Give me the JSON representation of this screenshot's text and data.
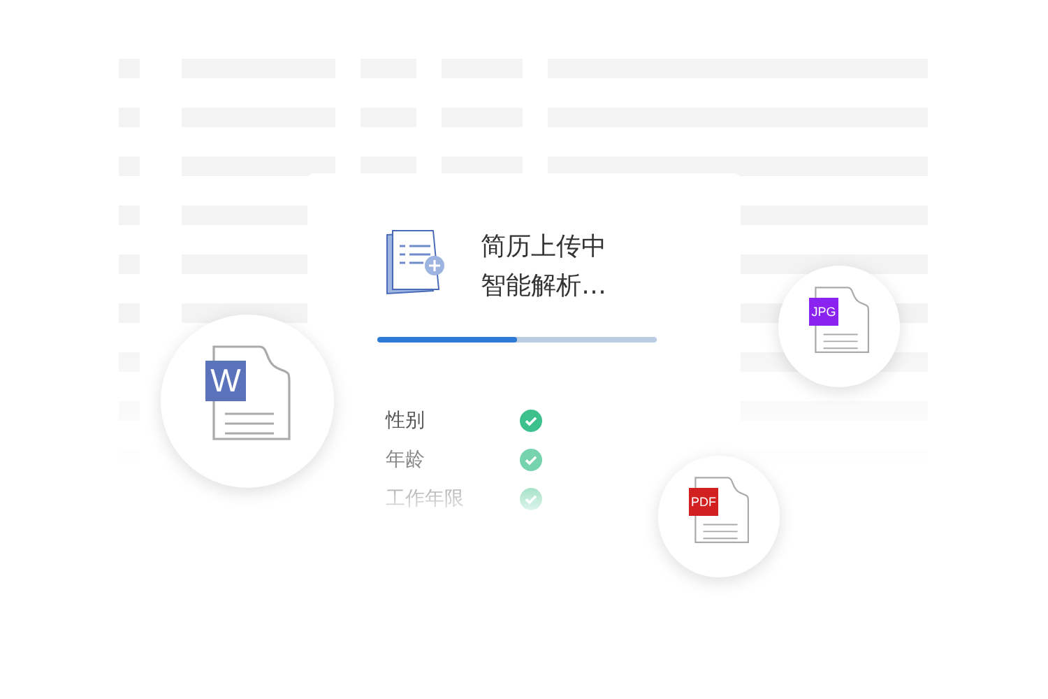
{
  "upload_card": {
    "title_lines": [
      "简历上传中",
      "智能解析…"
    ],
    "progress": {
      "level": 0.5
    },
    "fields": [
      {
        "label": "性别",
        "checked": true
      },
      {
        "label": "年龄",
        "checked": true
      },
      {
        "label": "工作年限",
        "checked": true
      }
    ]
  },
  "file_bubbles": [
    {
      "badge": "W",
      "color": "#5b73bb"
    },
    {
      "badge": "JPG",
      "color": "#8a23f0"
    },
    {
      "badge": "PDF",
      "color": "#d21f1f"
    }
  ]
}
